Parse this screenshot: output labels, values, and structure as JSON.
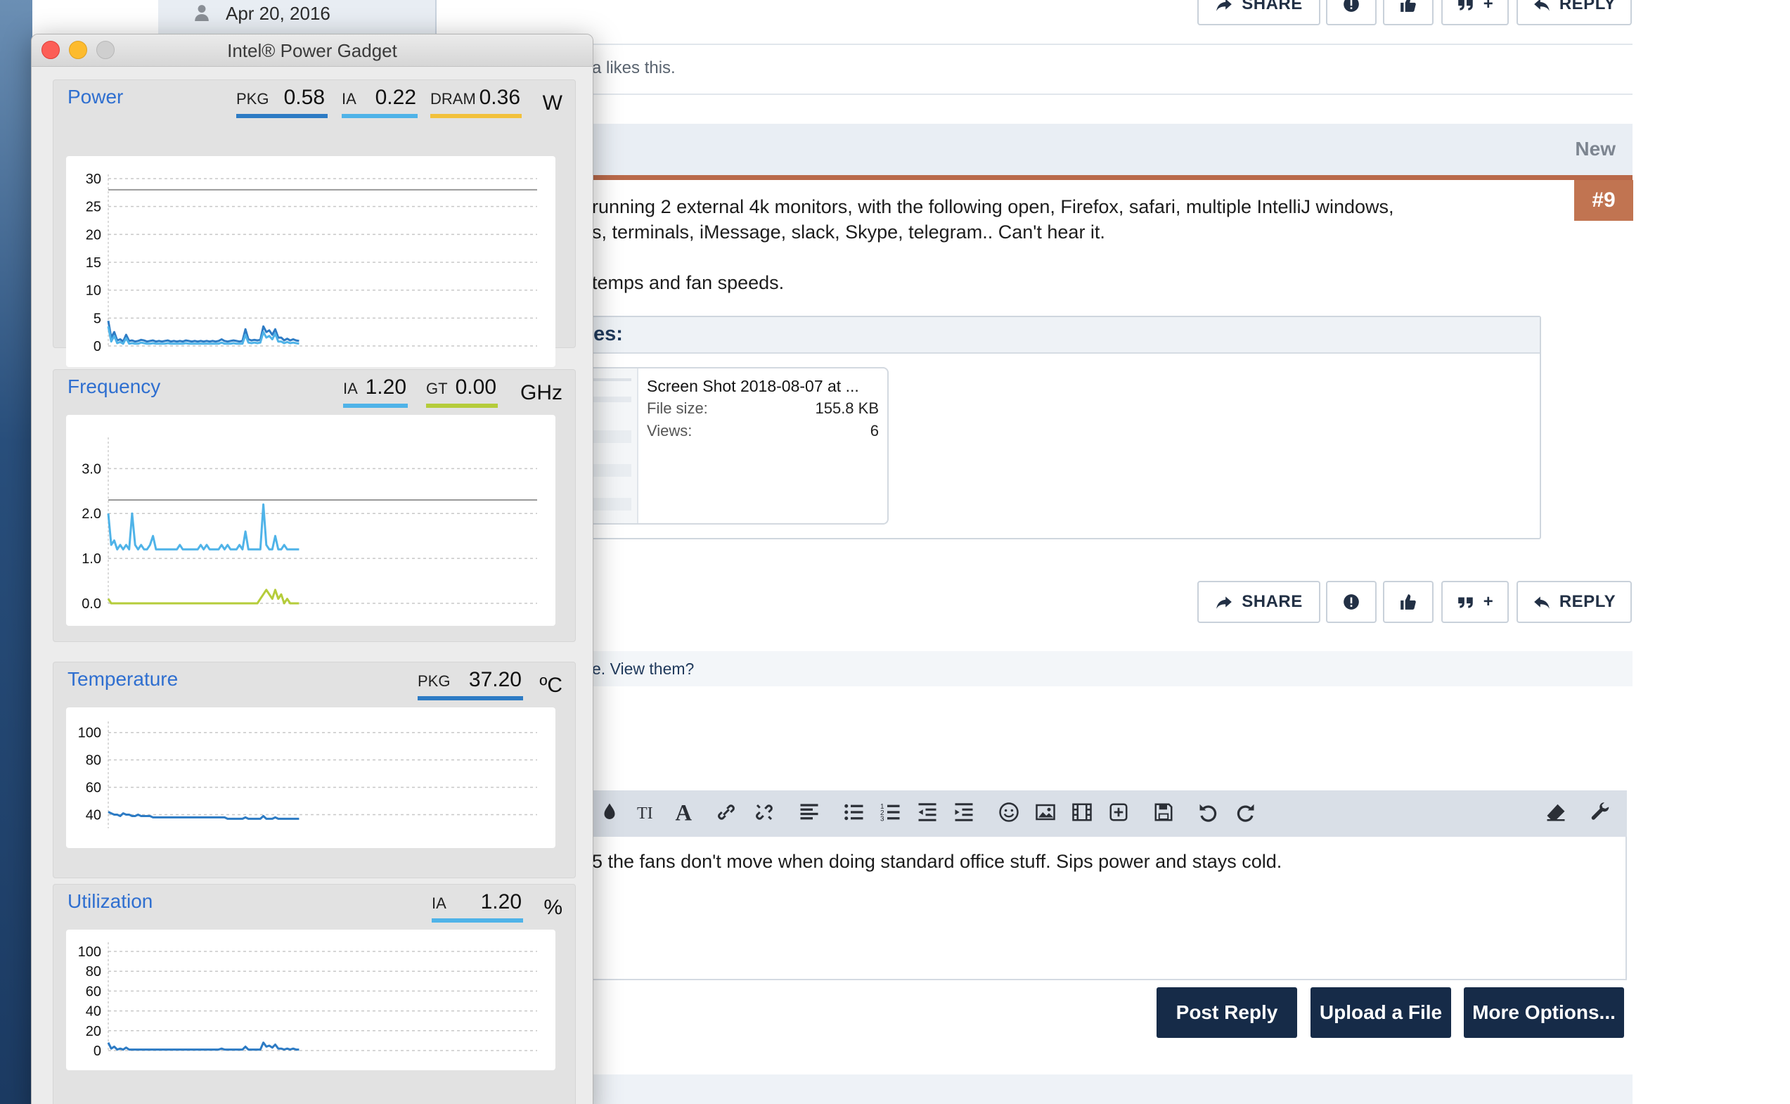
{
  "forum": {
    "top_date": "Apr 20, 2016",
    "likes_text": "a likes this.",
    "new_label": "New",
    "post_number": "#9",
    "post_lines": [
      "running 2 external 4k monitors, with the following open, Firefox, safari, multiple IntelliJ windows,",
      "s, terminals, iMessage, slack, Skype, telegram.. Can't hear it.",
      "temps and fan speeds."
    ],
    "attachments_heading": "es:",
    "attachment": {
      "name": "Screen Shot 2018-08-07 at ...",
      "file_size_label": "File size:",
      "file_size": "155.8 KB",
      "views_label": "Views:",
      "views": "6"
    },
    "buttons": {
      "share": "SHARE",
      "reply": "REPLY",
      "quote_plus": "+"
    },
    "notice_text": "e. View them?",
    "editor_text": "5 the fans don't move when doing standard office stuff.  Sips power and stays cold.",
    "submit": {
      "post_reply": "Post Reply",
      "upload": "Upload a File",
      "more": "More Options..."
    }
  },
  "gadget": {
    "title": "Intel® Power Gadget",
    "power": {
      "title": "Power",
      "unit": "W",
      "metrics": [
        {
          "label": "PKG",
          "value": "0.58",
          "color": "#2d7bc4"
        },
        {
          "label": "IA",
          "value": "0.22",
          "color": "#4fb3e8"
        },
        {
          "label": "DRAM",
          "value": "0.36",
          "color": "#f2c13b"
        }
      ]
    },
    "frequency": {
      "title": "Frequency",
      "unit": "GHz",
      "metrics": [
        {
          "label": "IA",
          "value": "1.20",
          "color": "#4fb3e8"
        },
        {
          "label": "GT",
          "value": "0.00",
          "color": "#b5cc3a"
        }
      ]
    },
    "temperature": {
      "title": "Temperature",
      "unit": "ºC",
      "metrics": [
        {
          "label": "PKG",
          "value": "37.20",
          "color": "#2d7bc4"
        }
      ]
    },
    "utilization": {
      "title": "Utilization",
      "unit": "%",
      "metrics": [
        {
          "label": "IA",
          "value": "1.20",
          "color": "#4fb3e8"
        }
      ]
    }
  },
  "chart_data": [
    {
      "type": "line",
      "title": "Power",
      "ylim": [
        0,
        30
      ],
      "yticks": [
        "0",
        "5",
        "10",
        "15",
        "20",
        "25",
        "30"
      ],
      "reference_line": 28,
      "grid": true,
      "series": [
        {
          "name": "PKG",
          "color": "#2d7bc4",
          "values": [
            4.5,
            1.5,
            2.5,
            1.0,
            1.2,
            0.8,
            2.0,
            0.9,
            1.0,
            0.8,
            0.9,
            1.1,
            1.0,
            0.8,
            0.9,
            1.0,
            0.8,
            0.9,
            0.8,
            0.9,
            1.0,
            0.8,
            0.9,
            0.8,
            0.9,
            0.8,
            1.0,
            0.9,
            0.8,
            0.9,
            0.8,
            0.9,
            0.8,
            0.9,
            0.8,
            0.9,
            0.8,
            0.9,
            1.2,
            0.9,
            0.8,
            0.9,
            1.0,
            0.9,
            0.8,
            0.9,
            3.0,
            1.2,
            1.0,
            1.1,
            1.0,
            1.1,
            3.5,
            2.5,
            2.8,
            2.0,
            3.0,
            1.5,
            1.5,
            1.0,
            1.3,
            1.0,
            1.2,
            1.0,
            0.9
          ]
        },
        {
          "name": "IA",
          "color": "#4fb3e8",
          "values": [
            3.5,
            0.8,
            1.8,
            0.5,
            0.7,
            0.4,
            1.4,
            0.4,
            0.5,
            0.4,
            0.4,
            0.6,
            0.5,
            0.4,
            0.4,
            0.5,
            0.4,
            0.4,
            0.4,
            0.4,
            0.5,
            0.4,
            0.4,
            0.4,
            0.4,
            0.4,
            0.5,
            0.4,
            0.4,
            0.4,
            0.4,
            0.4,
            0.4,
            0.4,
            0.4,
            0.4,
            0.4,
            0.4,
            0.6,
            0.4,
            0.4,
            0.4,
            0.5,
            0.4,
            0.4,
            0.4,
            2.0,
            0.6,
            0.5,
            0.6,
            0.5,
            0.6,
            2.5,
            1.5,
            1.8,
            1.2,
            2.2,
            0.8,
            0.8,
            0.5,
            0.7,
            0.5,
            0.6,
            0.5,
            0.4
          ]
        }
      ]
    },
    {
      "type": "line",
      "title": "Frequency",
      "ylim": [
        0,
        3.6
      ],
      "yticks": [
        "0.0",
        "1.0",
        "2.0",
        "3.0"
      ],
      "reference_line": 2.3,
      "grid": true,
      "series": [
        {
          "name": "IA",
          "color": "#4fb3e8",
          "values": [
            2.0,
            1.3,
            1.4,
            1.2,
            1.3,
            1.2,
            1.3,
            1.2,
            2.0,
            1.3,
            1.2,
            1.3,
            1.2,
            1.2,
            1.3,
            1.5,
            1.2,
            1.2,
            1.2,
            1.2,
            1.2,
            1.2,
            1.2,
            1.2,
            1.3,
            1.2,
            1.2,
            1.2,
            1.2,
            1.2,
            1.2,
            1.3,
            1.2,
            1.3,
            1.2,
            1.2,
            1.2,
            1.2,
            1.3,
            1.2,
            1.3,
            1.2,
            1.2,
            1.2,
            1.3,
            1.2,
            1.6,
            1.2,
            1.2,
            1.2,
            1.2,
            1.2,
            2.2,
            1.3,
            1.2,
            1.2,
            1.5,
            1.2,
            1.2,
            1.3,
            1.2,
            1.2,
            1.2,
            1.2,
            1.2
          ]
        },
        {
          "name": "GT",
          "color": "#b5cc3a",
          "values": [
            0.1,
            0.0,
            0.0,
            0.0,
            0.0,
            0.0,
            0.0,
            0.0,
            0.0,
            0.0,
            0.0,
            0.0,
            0.0,
            0.0,
            0.0,
            0.0,
            0.0,
            0.0,
            0.0,
            0.0,
            0.0,
            0.0,
            0.0,
            0.0,
            0.0,
            0.0,
            0.0,
            0.0,
            0.0,
            0.0,
            0.0,
            0.0,
            0.0,
            0.0,
            0.0,
            0.0,
            0.0,
            0.0,
            0.0,
            0.0,
            0.0,
            0.0,
            0.0,
            0.0,
            0.0,
            0.0,
            0.0,
            0.0,
            0.0,
            0.0,
            0.0,
            0.1,
            0.2,
            0.3,
            0.2,
            0.1,
            0.3,
            0.1,
            0.2,
            0.0,
            0.1,
            0.0,
            0.0,
            0.0,
            0.0
          ]
        }
      ]
    },
    {
      "type": "line",
      "title": "Temperature",
      "ylim": [
        30,
        105
      ],
      "yticks": [
        "40",
        "60",
        "80",
        "100"
      ],
      "grid": true,
      "series": [
        {
          "name": "PKG",
          "color": "#2d7bc4",
          "values": [
            42,
            41,
            40,
            40,
            39,
            41,
            40,
            40,
            39,
            39,
            40,
            39,
            39,
            39,
            39,
            38,
            38,
            38,
            38,
            38,
            38,
            38,
            38,
            38,
            38,
            38,
            38,
            38,
            38,
            38,
            38,
            38,
            38,
            38,
            38,
            38,
            38,
            38,
            38,
            38,
            37,
            37,
            37,
            37,
            37,
            37,
            38,
            37,
            37,
            37,
            37,
            37,
            39,
            37,
            37,
            37,
            38,
            37,
            37,
            37,
            37,
            37,
            37,
            37,
            37
          ]
        }
      ]
    },
    {
      "type": "line",
      "title": "Utilization",
      "ylim": [
        0,
        105
      ],
      "yticks": [
        "0",
        "20",
        "40",
        "60",
        "80",
        "100"
      ],
      "grid": true,
      "series": [
        {
          "name": "IA",
          "color": "#2d7bc4",
          "values": [
            8,
            2,
            4,
            1,
            2,
            1,
            3,
            1,
            1,
            1,
            1,
            1,
            1,
            1,
            1,
            1,
            1,
            1,
            1,
            1,
            1,
            1,
            1,
            1,
            1,
            1,
            1,
            1,
            1,
            1,
            1,
            1,
            1,
            1,
            1,
            1,
            1,
            1,
            2,
            1,
            1,
            1,
            1,
            1,
            1,
            1,
            4,
            1,
            1,
            1,
            1,
            1,
            8,
            4,
            5,
            3,
            6,
            2,
            2,
            1,
            2,
            1,
            2,
            1,
            1
          ]
        }
      ]
    }
  ]
}
